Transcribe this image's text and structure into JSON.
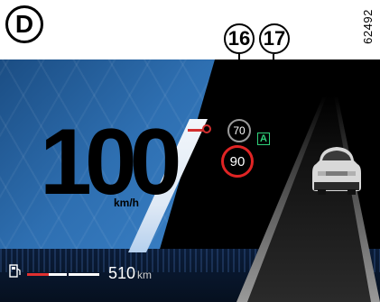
{
  "figure": {
    "panel_letter": "D",
    "reference_code": "62492",
    "callouts": [
      "16",
      "17"
    ]
  },
  "cluster": {
    "speed": "100",
    "speed_unit": "km/h",
    "set_speed": "70",
    "speed_limit": "90",
    "auto_mode_label": "A",
    "range_value": "510",
    "range_unit": "km"
  },
  "icons": {
    "fuel": "fuel-pump-icon",
    "car": "car-rear-icon",
    "auto": "auto-speed-icon"
  },
  "colors": {
    "panel_blue": "#2e6fb1",
    "limit_red": "#e02424",
    "auto_green": "#2fd07a"
  }
}
